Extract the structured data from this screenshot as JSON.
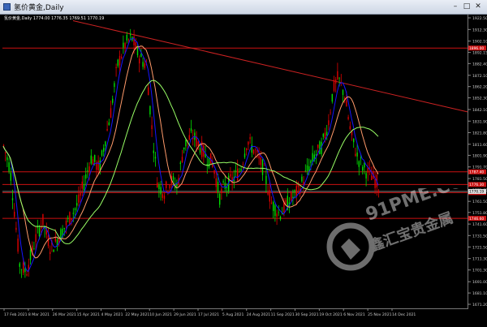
{
  "window": {
    "title": "氢价黄金,Daily",
    "controls": [
      "–",
      "□",
      "✕"
    ]
  },
  "chart_header": "氢价黄金,Daily  1774.00 1776.35 1769.51 1770.19",
  "chart_data": {
    "type": "candlestick",
    "symbol": "氢价黄金",
    "timeframe": "Daily",
    "ohlc": {
      "open": 1774.0,
      "high": 1776.35,
      "low": 1769.51,
      "close": 1770.19
    },
    "y_ticks": [
      1922.5,
      1912.3,
      1902.1,
      1892.15,
      1882.4,
      1872.1,
      1862.2,
      1852.3,
      1842.1,
      1831.9,
      1821.8,
      1811.6,
      1801.9,
      1791.7,
      1781.5,
      1771.65,
      1761.5,
      1751.8,
      1741.6,
      1731.5,
      1721.5,
      1711.3,
      1701.3,
      1691.0,
      1681.1,
      1671.2
    ],
    "x_labels": [
      "17 Feb 2021",
      "8 Mar 2021",
      "26 Mar 2021",
      "15 Apr 2021",
      "4 May 2021",
      "22 May 2021",
      "10 Jun 2021",
      "29 Jun 2021",
      "17 Jul 2021",
      "5 Aug 2021",
      "24 Aug 2021",
      "11 Sep 2021",
      "30 Sep 2021",
      "19 Oct 2021",
      "6 Nov 2021",
      "25 Nov 2021",
      "14 Dec 2021"
    ],
    "horizontal_levels": [
      {
        "price": 1896.0,
        "label": "1896.00"
      },
      {
        "price": 1787.4,
        "label": "1787.40"
      },
      {
        "price": 1776.3,
        "label": "1776.30"
      },
      {
        "price": 1769.2,
        "label": "1769.20"
      },
      {
        "price": 1746.6,
        "label": "1746.60"
      }
    ],
    "trendline": {
      "from": {
        "date": "17 Feb 2021",
        "price": 1920
      },
      "to": {
        "date": "14 Dec 2021",
        "price": 1840
      }
    },
    "moving_averages": [
      {
        "color": "#1515ff"
      },
      {
        "color": "#ff9a6a"
      },
      {
        "color": "#99ff66"
      }
    ],
    "colors": {
      "up": "#00e000",
      "down": "#e00000",
      "level": "#cc1111",
      "trend": "#cc2222",
      "current_price": "#c0c0c0"
    },
    "grid": false,
    "current_price": 1770.19,
    "current_label": "1770.19"
  },
  "watermark": {
    "brand": "91PME.COM",
    "tagline": "鑫汇宝贵金属"
  }
}
